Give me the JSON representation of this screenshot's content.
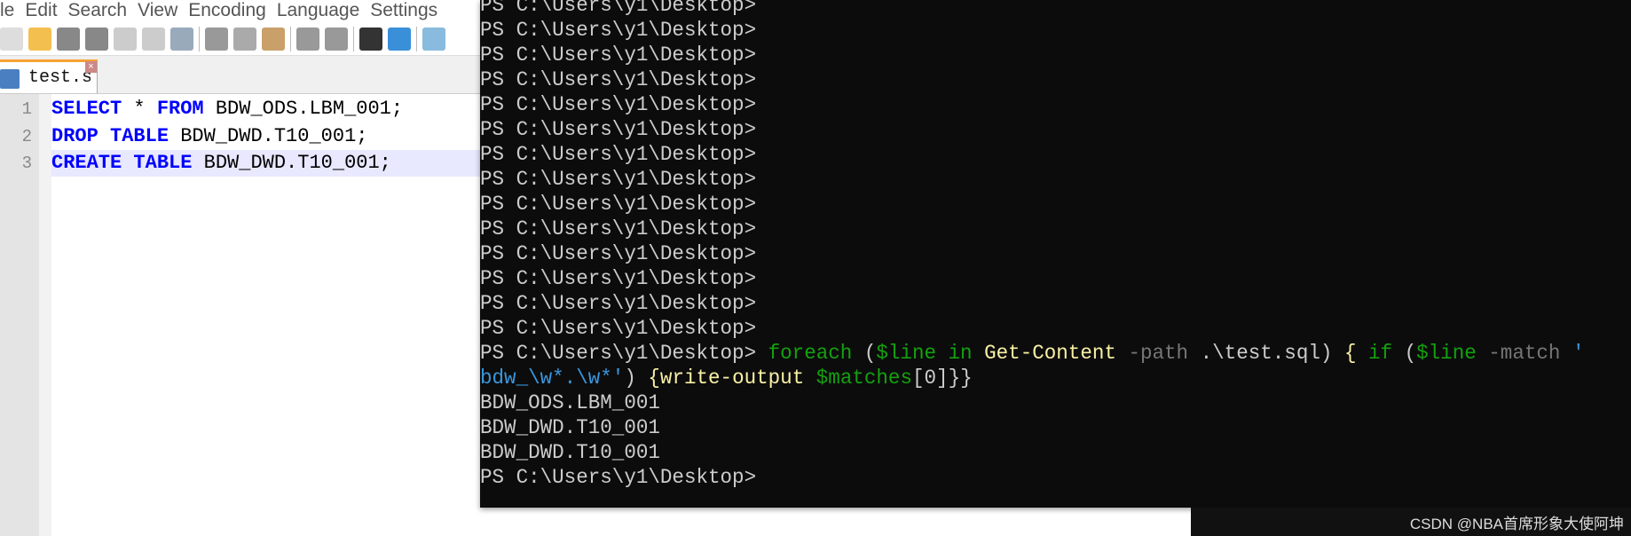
{
  "editor": {
    "menu": [
      "le",
      "Edit",
      "Search",
      "View",
      "Encoding",
      "Language",
      "Settings"
    ],
    "tab_label": "test.sql",
    "lines": [
      {
        "num": "1",
        "kw1": "SELECT",
        "mid": " * ",
        "kw2": "FROM",
        "rest": " BDW_ODS.LBM_001;"
      },
      {
        "num": "2",
        "kw1": "DROP",
        "mid": " ",
        "kw2": "TABLE",
        "rest": " BDW_DWD.T10_001;"
      },
      {
        "num": "3",
        "kw1": "CREATE",
        "mid": " ",
        "kw2": "TABLE",
        "rest": " BDW_DWD.T10_001;"
      }
    ],
    "current_line": 3
  },
  "terminal": {
    "prompt": "PS C:\\Users\\y1\\Desktop>",
    "empty_prompts": 15,
    "command": {
      "p1": " foreach",
      "p2": " (",
      "p3": "$line in",
      "p4": " Get-Content",
      "p5": " -path",
      "p6": " .\\test.sql)",
      "p7": " {",
      "p8": " if",
      "p9": " (",
      "p10": "$line",
      "p11": " -match",
      "p12": " '",
      "p13": "bdw_\\w*.\\w*'",
      "p14": ") ",
      "p15": "{",
      "p16": "write-output",
      "p17": " $matches",
      "p18": "[0]",
      "p19": "}}"
    },
    "output": [
      "BDW_ODS.LBM_001",
      "BDW_DWD.T10_001",
      "BDW_DWD.T10_001"
    ]
  },
  "watermark": "CSDN @NBA首席形象大使阿坤"
}
